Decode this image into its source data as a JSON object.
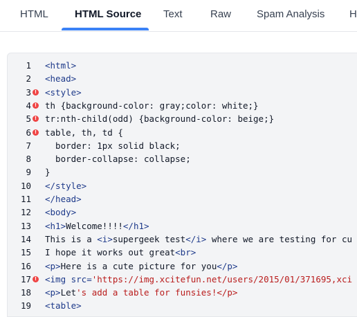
{
  "tabs": [
    {
      "label": "HTML",
      "active": false
    },
    {
      "label": "HTML Source",
      "active": true
    },
    {
      "label": "Text",
      "active": false
    },
    {
      "label": "Raw",
      "active": false
    },
    {
      "label": "Spam Analysis",
      "active": false
    },
    {
      "label": "H",
      "active": false
    }
  ],
  "colors": {
    "accent": "#3b82f6",
    "error": "#ef4444",
    "tag": "#1e3a8a",
    "string": "#b91c1c"
  },
  "code_lines": [
    {
      "num": "1",
      "error": false,
      "text": "<html>"
    },
    {
      "num": "2",
      "error": false,
      "text": "<head>"
    },
    {
      "num": "3",
      "error": true,
      "text": "<style>"
    },
    {
      "num": "4",
      "error": true,
      "text": "th {background-color: gray;color: white;}"
    },
    {
      "num": "5",
      "error": true,
      "text": "tr:nth-child(odd) {background-color: beige;}"
    },
    {
      "num": "6",
      "error": true,
      "text": "table, th, td {"
    },
    {
      "num": "7",
      "error": false,
      "text": "  border: 1px solid black;"
    },
    {
      "num": "8",
      "error": false,
      "text": "  border-collapse: collapse;"
    },
    {
      "num": "9",
      "error": false,
      "text": "}"
    },
    {
      "num": "10",
      "error": false,
      "text": "</style>"
    },
    {
      "num": "11",
      "error": false,
      "text": "</head>"
    },
    {
      "num": "12",
      "error": false,
      "text": "<body>"
    },
    {
      "num": "13",
      "error": false,
      "text": "<h1>Welcome!!!!</h1>"
    },
    {
      "num": "14",
      "error": false,
      "text": "This is a <i>supergeek test</i> where we are testing for cu"
    },
    {
      "num": "15",
      "error": false,
      "text": "I hope it works out great<br>"
    },
    {
      "num": "16",
      "error": false,
      "text": "<p>Here is a cute picture for you</p>"
    },
    {
      "num": "17",
      "error": true,
      "text": "<img src='https://img.xcitefun.net/users/2015/01/371695,xci"
    },
    {
      "num": "18",
      "error": false,
      "text": "<p>Let's add a table for funsies!</p>"
    },
    {
      "num": "19",
      "error": false,
      "text": "<table>"
    }
  ]
}
